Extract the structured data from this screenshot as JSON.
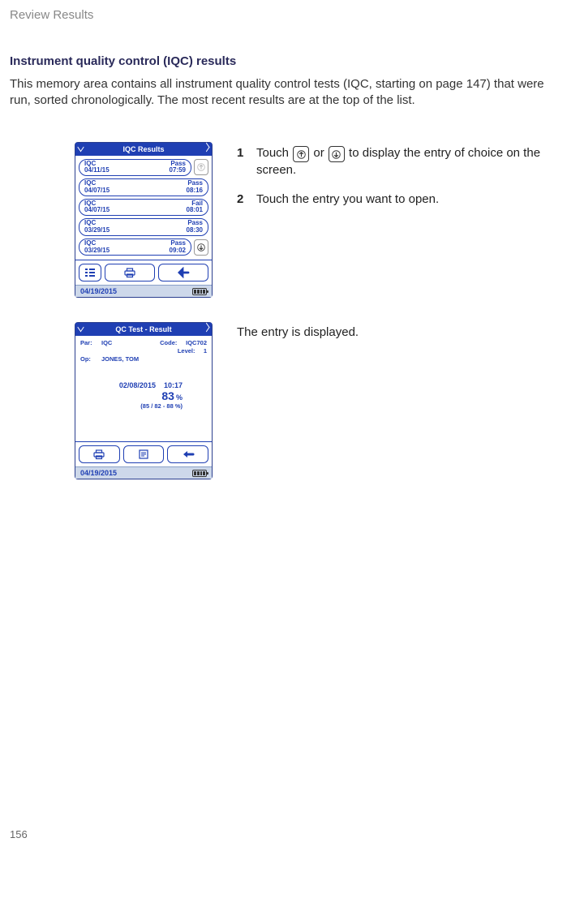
{
  "running_head": "Review Results",
  "section_title": "Instrument quality control (IQC) results",
  "section_body": "This memory area contains all instrument quality control tests (IQC, starting on page 147) that were run, sorted chronologically. The most recent results are at the top of the list.",
  "steps": [
    {
      "num": "1",
      "text_before": "Touch ",
      "text_mid": " or ",
      "text_after": " to display the entry of choice on the screen."
    },
    {
      "num": "2",
      "text_before": "Touch the entry you want to open.",
      "text_mid": "",
      "text_after": ""
    }
  ],
  "entry_displayed_text": "The entry is displayed.",
  "screen1": {
    "title": "IQC Results",
    "entries": [
      {
        "name": "IQC",
        "date": "04/11/15",
        "status": "Pass",
        "time": "07:59"
      },
      {
        "name": "IQC",
        "date": "04/07/15",
        "status": "Pass",
        "time": "08:16"
      },
      {
        "name": "IQC",
        "date": "04/07/15",
        "status": "Fail",
        "time": "08:01"
      },
      {
        "name": "IQC",
        "date": "03/29/15",
        "status": "Pass",
        "time": "08:30"
      },
      {
        "name": "IQC",
        "date": "03/29/15",
        "status": "Pass",
        "time": "09:02"
      }
    ],
    "status_date": "04/19/2015"
  },
  "screen2": {
    "title": "QC Test - Result",
    "labels": {
      "par": "Par:",
      "op": "Op:",
      "code": "Code:",
      "level": "Level:"
    },
    "par": "IQC",
    "code": "IQC702",
    "level": "1",
    "op": "JONES, TOM",
    "result_date": "02/08/2015",
    "result_time": "10:17",
    "result_value": "83",
    "result_unit": "%",
    "result_range": "(85 / 82 - 88 %)",
    "status_date": "04/19/2015"
  },
  "page_number": "156"
}
